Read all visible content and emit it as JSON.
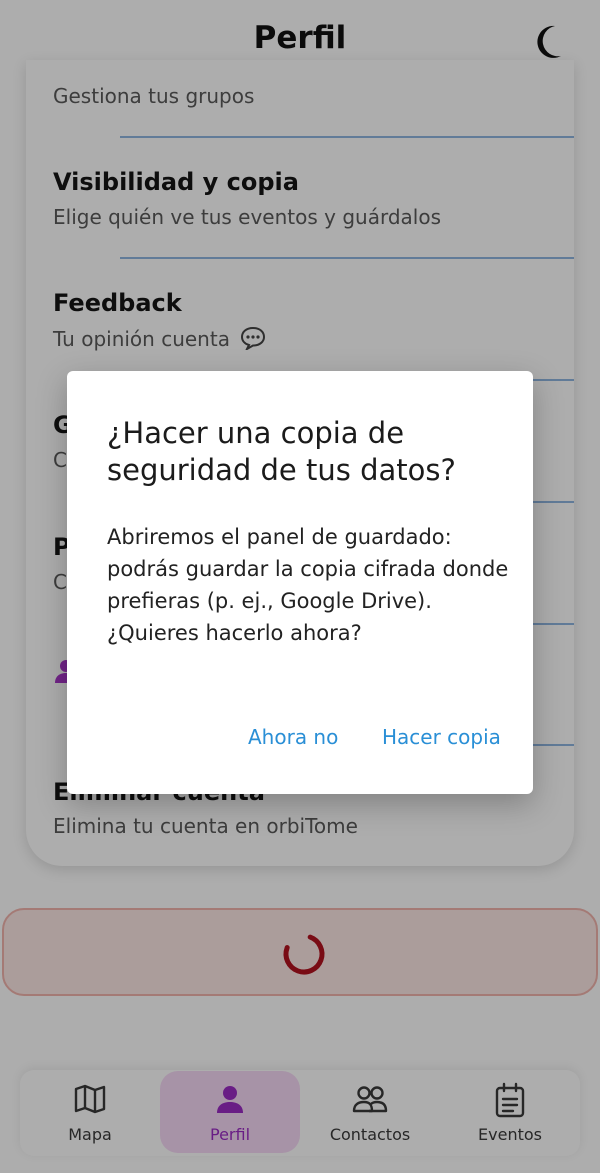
{
  "header": {
    "title": "Perfil",
    "theme_icon": "moon-icon"
  },
  "settings": {
    "items": [
      {
        "title": "",
        "subtitle": "Gestiona tus grupos"
      },
      {
        "title": "Visibilidad y copia",
        "subtitle": "Elige quién ve tus eventos y guárdalos"
      },
      {
        "title": "Feedback",
        "subtitle": "Tu opinión cuenta"
      },
      {
        "title": "G",
        "subtitle": "C"
      },
      {
        "title": "P",
        "subtitle": "C"
      },
      {
        "title": "Eliminar cuenta",
        "subtitle": "Elimina tu cuenta en orbiTome"
      }
    ],
    "feedback_icon": "speech-bubble-icon"
  },
  "loading_button": {
    "state": "loading",
    "icon": "spinner-icon",
    "color": "#b3121f"
  },
  "bottom_nav": {
    "items": [
      {
        "label": "Mapa",
        "icon": "map-icon",
        "active": false
      },
      {
        "label": "Perfil",
        "icon": "person-icon",
        "active": true
      },
      {
        "label": "Contactos",
        "icon": "people-icon",
        "active": false
      },
      {
        "label": "Eventos",
        "icon": "calendar-list-icon",
        "active": false
      }
    ],
    "active_color": "#9b2cc4"
  },
  "dialog": {
    "title": "¿Hacer una copia de seguridad de tus datos?",
    "body": "Abriremos el panel de guardado: podrás guardar la copia cifrada donde prefieras (p. ej., Google Drive). ¿Quieres hacerlo ahora?",
    "cancel_label": "Ahora no",
    "confirm_label": "Hacer copia",
    "button_color": "#2a8fd6"
  }
}
